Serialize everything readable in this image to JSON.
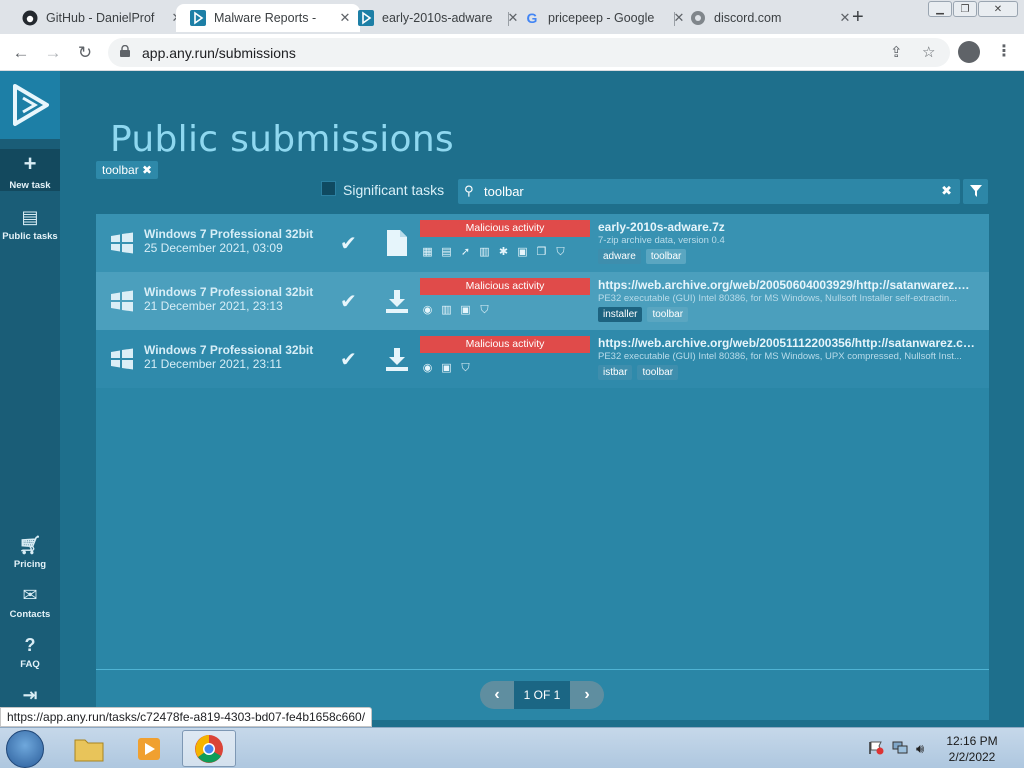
{
  "browser": {
    "tabs": [
      {
        "title": "GitHub - DanielProf",
        "icon": "github-icon"
      },
      {
        "title": "Malware Reports - ",
        "icon": "anyrun-icon"
      },
      {
        "title": "early-2010s-adware",
        "icon": "anyrun-icon"
      },
      {
        "title": "pricepeep - Google",
        "icon": "google-icon"
      },
      {
        "title": "discord.com",
        "icon": "globe-icon"
      }
    ],
    "url": "app.any.run/submissions",
    "status_url": "https://app.any.run/tasks/c72478fe-a819-4303-bd07-fe4b1658c660/"
  },
  "sidebar": {
    "new_task": "New task",
    "public_tasks": "Public tasks",
    "pricing": "Pricing",
    "contacts": "Contacts",
    "faq": "FAQ"
  },
  "page": {
    "title": "Public submissions",
    "filter_chip": "toolbar ✖",
    "significant_label": "Significant tasks",
    "search_value": "toolbar"
  },
  "rows": [
    {
      "os": "Windows 7 Professional 32bit",
      "date": "25 December 2021, 03:09",
      "type_icon": "file-icon",
      "verdict": "Malicious activity",
      "title": "early-2010s-adware.7z",
      "desc": "7-zip archive data, version 0.4",
      "tags": [
        "adware",
        "toolbar"
      ]
    },
    {
      "os": "Windows 7 Professional 32bit",
      "date": "21 December 2021, 23:13",
      "type_icon": "download-icon",
      "verdict": "Malicious activity",
      "title": "https://web.archive.org/web/20050604003929/http://satanwarez.co...",
      "desc": "PE32 executable (GUI) Intel 80386, for MS Windows, Nullsoft Installer self-extractin...",
      "tags": [
        "installer",
        "toolbar"
      ]
    },
    {
      "os": "Windows 7 Professional 32bit",
      "date": "21 December 2021, 23:11",
      "type_icon": "download-icon",
      "verdict": "Malicious activity",
      "title": "https://web.archive.org/web/20051112200356/http://satanwarez.co...",
      "desc": "PE32 executable (GUI) Intel 80386, for MS Windows, UPX compressed, Nullsoft Inst...",
      "tags": [
        "istbar",
        "toolbar"
      ]
    }
  ],
  "pager": {
    "label": "1 OF 1"
  },
  "taskbar": {
    "time": "12:16 PM",
    "date": "2/2/2022"
  },
  "colors": {
    "verdict": "#e04b4a",
    "accent": "#1d7fa6",
    "background": "#1e6f8c"
  }
}
